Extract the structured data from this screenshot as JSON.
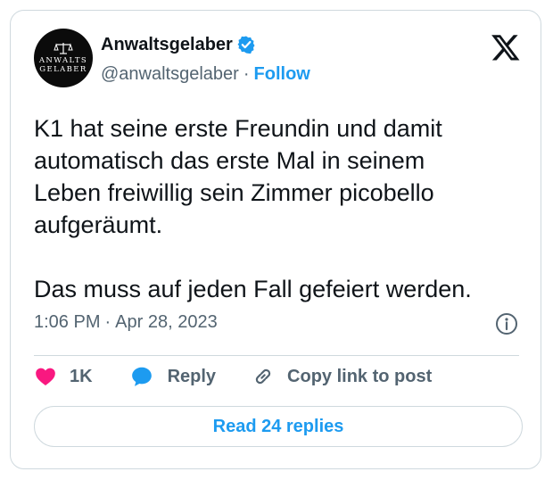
{
  "author": {
    "name": "Anwaltsgelaber",
    "handle": "@anwaltsgelaber",
    "separator": "·",
    "follow_label": "Follow",
    "avatar_line1": "ANWALTS",
    "avatar_line2": "GELABER",
    "verified": true
  },
  "tweet": {
    "text": "K1 hat seine erste Freundin und damit\nautomatisch das erste Mal in seinem\nLeben freiwillig sein Zimmer picobello\naufgeräumt.\n\nDas muss auf jeden Fall gefeiert werden.",
    "time": "1:06 PM",
    "separator": "·",
    "date": "Apr 28, 2023"
  },
  "actions": {
    "like_count": "1K",
    "reply_label": "Reply",
    "copy_label": "Copy link to post"
  },
  "footer": {
    "read_replies_label": "Read 24 replies"
  },
  "colors": {
    "accent": "#1d9bf0",
    "like": "#f91880",
    "muted": "#536471",
    "border": "#cfd9de"
  },
  "icons": [
    "verified-badge-icon",
    "x-logo-icon",
    "info-icon",
    "heart-icon",
    "reply-bubble-icon",
    "link-icon",
    "scale-icon"
  ]
}
